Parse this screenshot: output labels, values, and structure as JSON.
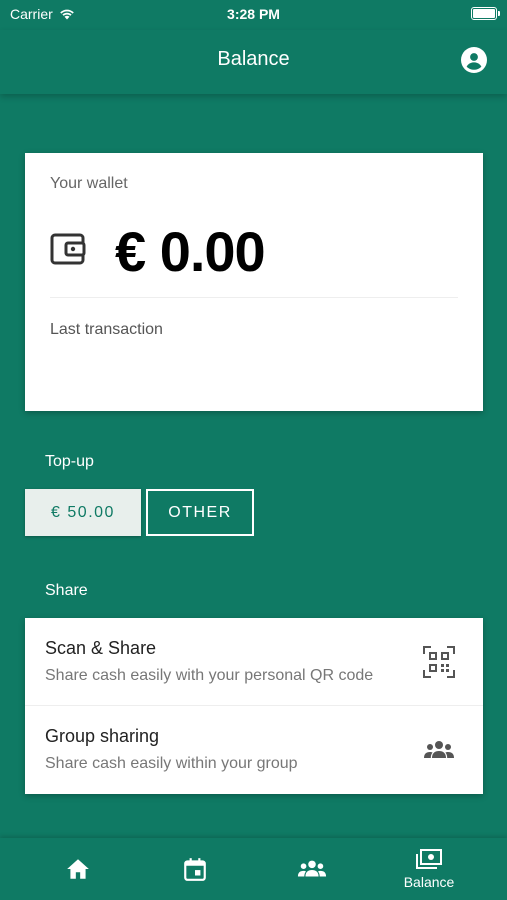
{
  "status_bar": {
    "carrier": "Carrier",
    "time": "3:28 PM"
  },
  "header": {
    "title": "Balance"
  },
  "wallet": {
    "label": "Your wallet",
    "amount": "€ 0.00",
    "last_transaction_label": "Last transaction"
  },
  "topup": {
    "title": "Top-up",
    "options": [
      {
        "label": "€ 50.00",
        "selected": true
      },
      {
        "label": "OTHER",
        "selected": false
      }
    ]
  },
  "share": {
    "title": "Share",
    "items": [
      {
        "name": "Scan & Share",
        "description": "Share cash easily with your personal QR code",
        "icon": "qr-code-icon"
      },
      {
        "name": "Group sharing",
        "description": "Share cash easily within your group",
        "icon": "group-icon"
      }
    ]
  },
  "bottom_nav": {
    "items": [
      {
        "icon": "home-icon",
        "label": ""
      },
      {
        "icon": "calendar-icon",
        "label": ""
      },
      {
        "icon": "group-icon",
        "label": ""
      },
      {
        "icon": "cash-icon",
        "label": "Balance",
        "active": true
      }
    ]
  },
  "colors": {
    "primary": "#0f7a64",
    "card": "#ffffff",
    "selected_button": "#e8efec"
  }
}
